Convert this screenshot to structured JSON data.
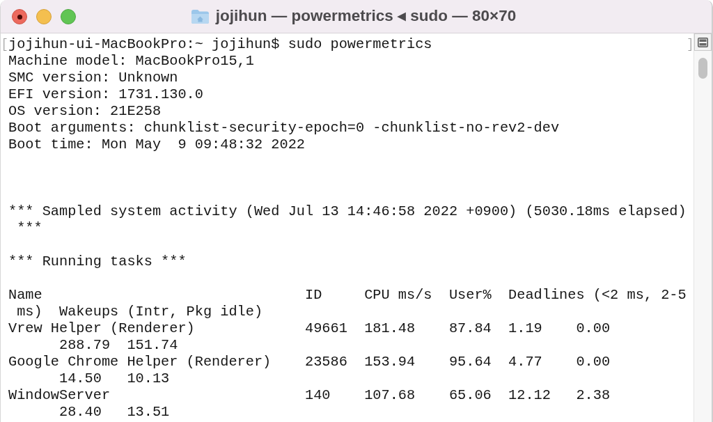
{
  "window": {
    "title": "jojihun — powermetrics ◂ sudo — 80×70"
  },
  "terminal": {
    "lines": [
      {
        "kind": "prompt",
        "text": "jojihun-ui-MacBookPro:~ jojihun$ sudo powermetrics"
      },
      {
        "kind": "output",
        "text": "Machine model: MacBookPro15,1"
      },
      {
        "kind": "output",
        "text": "SMC version: Unknown"
      },
      {
        "kind": "output",
        "text": "EFI version: 1731.130.0"
      },
      {
        "kind": "output",
        "text": "OS version: 21E258"
      },
      {
        "kind": "output",
        "text": "Boot arguments: chunklist-security-epoch=0 -chunklist-no-rev2-dev"
      },
      {
        "kind": "output",
        "text": "Boot time: Mon May  9 09:48:32 2022"
      },
      {
        "kind": "blank"
      },
      {
        "kind": "blank"
      },
      {
        "kind": "blank"
      },
      {
        "kind": "output",
        "text": "*** Sampled system activity (Wed Jul 13 14:46:58 2022 +0900) (5030.18ms elapsed)"
      },
      {
        "kind": "output",
        "text": " ***"
      },
      {
        "kind": "blank"
      },
      {
        "kind": "output",
        "text": "*** Running tasks ***"
      },
      {
        "kind": "blank"
      },
      {
        "kind": "output",
        "text": "Name                               ID     CPU ms/s  User%  Deadlines (<2 ms, 2-5"
      },
      {
        "kind": "output",
        "text": " ms)  Wakeups (Intr, Pkg idle)"
      },
      {
        "kind": "output",
        "text": "Vrew Helper (Renderer)             49661  181.48    87.84  1.19    0.00"
      },
      {
        "kind": "output",
        "text": "      288.79  151.74"
      },
      {
        "kind": "output",
        "text": "Google Chrome Helper (Renderer)    23586  153.94    95.64  4.77    0.00"
      },
      {
        "kind": "output",
        "text": "      14.50   10.13"
      },
      {
        "kind": "output",
        "text": "WindowServer                       140    107.68    65.06  12.12   2.38"
      },
      {
        "kind": "output",
        "text": "      28.40   13.51"
      }
    ]
  }
}
